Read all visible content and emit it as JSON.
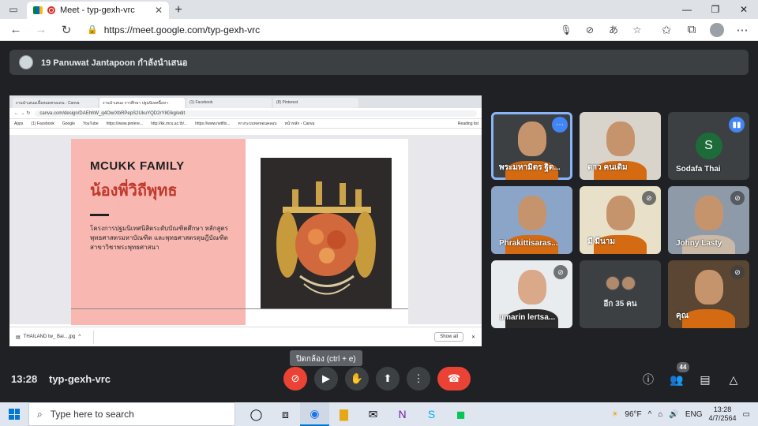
{
  "browser": {
    "tab_title": "Meet - typ-gexh-vrc",
    "tab_close": "✕",
    "new_tab": "+",
    "url": "https://meet.google.com/typ-gexh-vrc"
  },
  "presenter_banner": "19 Panuwat Jantapoon กำลังนำเสนอ",
  "shared_screen": {
    "tabs": [
      "งานนำเสนอเนื้อหมดทรอเคน - Canva",
      "งานนำเสนอ การศึกษา ปฐมนิเทศนื้อหา",
      "(1) Facebook",
      "(8) Pinterest"
    ],
    "url": "canva.com/design/DAEhhW_q4Ow/XbRPepS2UkuYQD2rY8Gkg/edit",
    "bookmarks": [
      "Apps",
      "(1) Facebook",
      "Google",
      "YouTube",
      "https://www.pintere...",
      "http://kk.mcu.ac.th/...",
      "https://www.netflix...",
      "ทางระบบทดทอนคลอบ",
      "หน้าหลัก - Canva",
      "Reading list"
    ],
    "slide": {
      "title_en": "MCUKK FAMILY",
      "title_th": "น้องพี่วิถีพุทธ",
      "description": "โครงการปฐมนิเทศนิสิตระดับบัณฑิตศึกษา หลักสูตรพุทธศาสตรมหาบัณฑิต และพุทธศาสตรดุษฎีบัณฑิต สาขาวิชาพระพุทธศาสนา"
    },
    "download": {
      "file": "THAILAND tw_ Bai....jpg",
      "show_all": "Show all"
    }
  },
  "participants": [
    {
      "name": "พระมหามิตร ฐิต...",
      "muted": false,
      "highlight": true
    },
    {
      "name": "ดาว คนเดิม",
      "muted": false
    },
    {
      "name": "Sodafa Thai",
      "initial": "S",
      "muted": false,
      "speaking": true
    },
    {
      "name": "Phrakittisaras...",
      "muted": false
    },
    {
      "name": "มี มีนาม",
      "muted": true
    },
    {
      "name": "Johny Lasty",
      "muted": true
    },
    {
      "name": "umarin lertsa...",
      "muted": true
    },
    {
      "name": "อีก 35 คน"
    },
    {
      "name": "คุณ",
      "muted": true
    }
  ],
  "controls": {
    "time": "13:28",
    "meeting_code": "typ-gexh-vrc",
    "tooltip": "ปิดกล้อง (ctrl + e)",
    "people_count": "44"
  },
  "taskbar": {
    "search_placeholder": "Type here to search",
    "weather": "96°F",
    "lang": "ENG",
    "clock_time": "13:28",
    "clock_date": "4/7/2564"
  },
  "colors": {
    "meet_bg": "#202124",
    "tile_bg": "#3c4043",
    "end_call": "#ea4335",
    "slide_pink": "#f8b7b1",
    "slide_title_th": "#c0392b"
  }
}
